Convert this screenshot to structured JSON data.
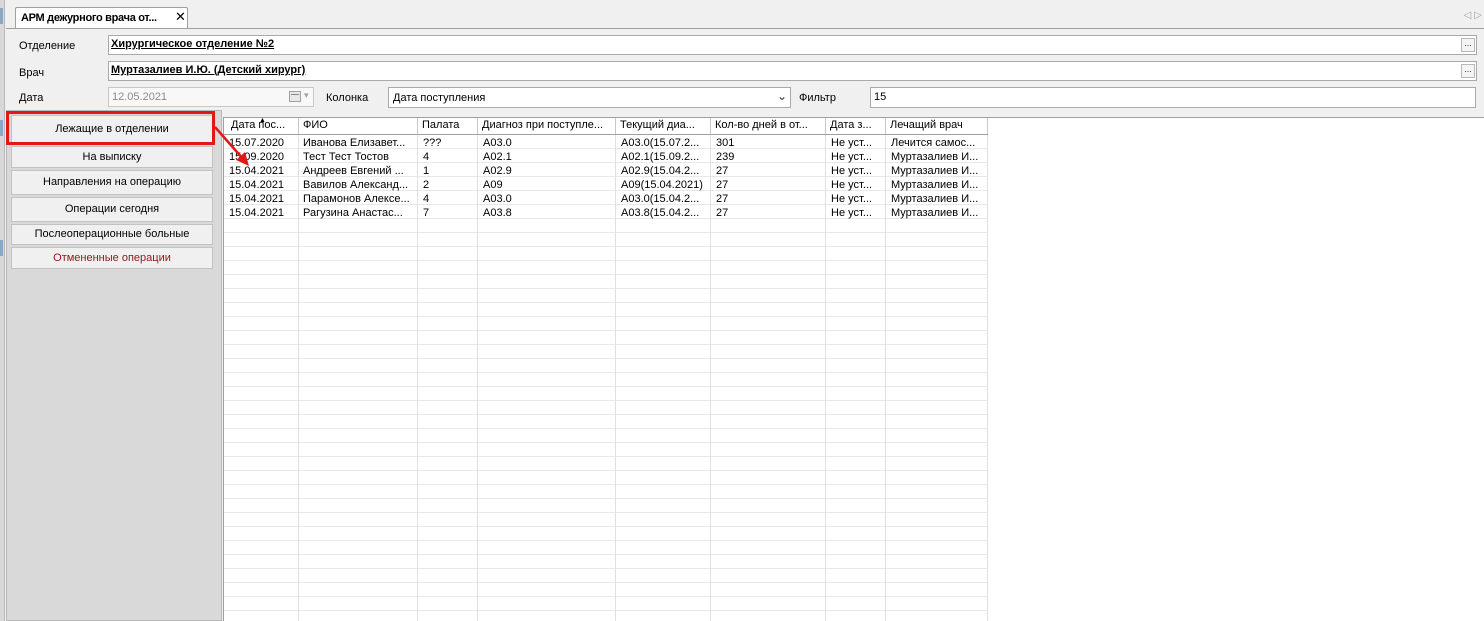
{
  "tab": {
    "title": "АРМ дежурного врача от...",
    "close_icon": "close-icon"
  },
  "form": {
    "department_label": "Отделение",
    "department_value": "Хирургическое отделение №2",
    "doctor_label": "Врач",
    "doctor_value": "Муртазалиев И.Ю. (Детский хирург)",
    "date_label": "Дата",
    "date_value": "12.05.2021",
    "column_label": "Колонка",
    "column_value": "Дата поступления",
    "filter_label": "Фильтр",
    "filter_value": "15",
    "ellipsis": "..."
  },
  "nav": {
    "items": [
      {
        "label": "Лежащие в отделении"
      },
      {
        "label": "На выписку"
      },
      {
        "label": "Направления на операцию"
      },
      {
        "label": "Операции сегодня"
      },
      {
        "label": "Послеоперационные больные"
      },
      {
        "label": "Отмененные операции"
      }
    ]
  },
  "table": {
    "columns": [
      "Дата пос...",
      "ФИО",
      "Палата",
      "Диагноз при поступле...",
      "Текущий диа...",
      "Кол-во дней в от...",
      "Дата з...",
      "Лечащий врач"
    ],
    "rows": [
      [
        "15.07.2020",
        "Иванова Елизавет...",
        "???",
        "A03.0",
        "A03.0(15.07.2...",
        "301",
        "Не уст...",
        "Лечится самос..."
      ],
      [
        "15.09.2020",
        "Тест Тест Тостов",
        "4",
        "A02.1",
        "A02.1(15.09.2...",
        "239",
        "Не уст...",
        "Муртазалиев И..."
      ],
      [
        "15.04.2021",
        "Андреев Евгений ...",
        "1",
        "A02.9",
        "A02.9(15.04.2...",
        "27",
        "Не уст...",
        "Муртазалиев И..."
      ],
      [
        "15.04.2021",
        "Вавилов Александ...",
        "2",
        "A09",
        "A09(15.04.2021)",
        "27",
        "Не уст...",
        "Муртазалиев И..."
      ],
      [
        "15.04.2021",
        "Парамонов Алексе...",
        "4",
        "A03.0",
        "A03.0(15.04.2...",
        "27",
        "Не уст...",
        "Муртазалиев И..."
      ],
      [
        "15.04.2021",
        "Рагузина Анастас...",
        "7",
        "A03.8",
        "A03.8(15.04.2...",
        "27",
        "Не уст...",
        "Муртазалиев И..."
      ]
    ]
  },
  "colors": {
    "highlight": "#e21818",
    "cancelled_text": "#8b1a1a"
  }
}
